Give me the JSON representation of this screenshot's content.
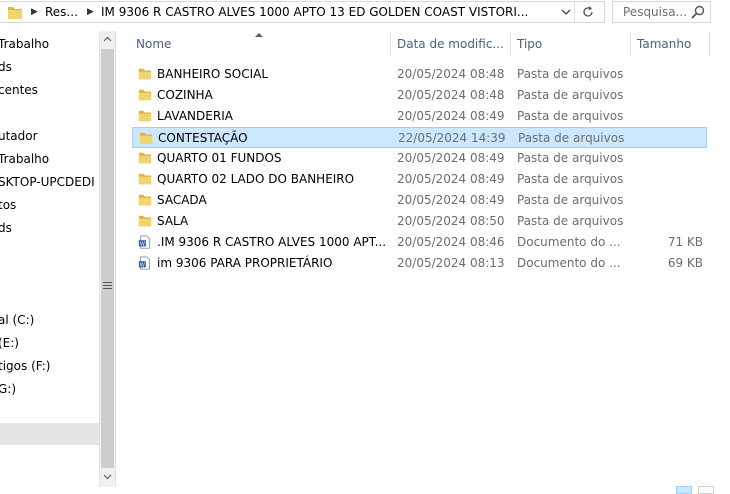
{
  "address": {
    "crumbs": [
      "Res...",
      "IM 9306 R CASTRO ALVES 1000 APTO 13 ED GOLDEN COAST VISTORI..."
    ],
    "icons": [
      "folder-icon",
      "chevron-right-icon",
      "chevron-down-icon",
      "refresh-icon"
    ]
  },
  "search": {
    "placeholder": "Pesquisa..."
  },
  "nav": {
    "items": [
      "Trabalho",
      "ds",
      "centes",
      "utador",
      "Trabalho",
      "SKTOP-UPCDEDI",
      "tos",
      "ds",
      "al (C:)",
      "(E:)",
      "tigos (F:)",
      "G:)"
    ]
  },
  "columns": {
    "name": "Nome",
    "date": "Data de modific...",
    "type": "Tipo",
    "size": "Tamanho"
  },
  "files": [
    {
      "name": "BANHEIRO SOCIAL",
      "date": "20/05/2024 08:48",
      "type": "Pasta de arquivos",
      "size": "",
      "icon": "folder-icon"
    },
    {
      "name": "COZINHA",
      "date": "20/05/2024 08:48",
      "type": "Pasta de arquivos",
      "size": "",
      "icon": "folder-icon"
    },
    {
      "name": "LAVANDERIA",
      "date": "20/05/2024 08:49",
      "type": "Pasta de arquivos",
      "size": "",
      "icon": "folder-icon"
    },
    {
      "name": "CONTESTAÇÃO",
      "date": "22/05/2024 14:39",
      "type": "Pasta de arquivos",
      "size": "",
      "icon": "folder-icon",
      "selected": true
    },
    {
      "name": "QUARTO 01 FUNDOS",
      "date": "20/05/2024 08:49",
      "type": "Pasta de arquivos",
      "size": "",
      "icon": "folder-icon"
    },
    {
      "name": "QUARTO 02 LADO DO BANHEIRO",
      "date": "20/05/2024 08:49",
      "type": "Pasta de arquivos",
      "size": "",
      "icon": "folder-icon"
    },
    {
      "name": "SACADA",
      "date": "20/05/2024 08:49",
      "type": "Pasta de arquivos",
      "size": "",
      "icon": "folder-icon"
    },
    {
      "name": "SALA",
      "date": "20/05/2024 08:50",
      "type": "Pasta de arquivos",
      "size": "",
      "icon": "folder-icon"
    },
    {
      "name": ".IM 9306 R CASTRO ALVES 1000 APT...",
      "date": "20/05/2024 08:46",
      "type": "Documento do ...",
      "size": "71 KB",
      "icon": "word-doc-icon"
    },
    {
      "name": "im 9306 PARA PROPRIETÁRIO",
      "date": "20/05/2024 08:13",
      "type": "Documento do ...",
      "size": "69 KB",
      "icon": "word-doc-icon"
    }
  ],
  "colors": {
    "selection_bg": "#cce8ff",
    "selection_border": "#99d1ff",
    "header_text": "#4c607a",
    "meta_text": "#6d6d6d"
  }
}
